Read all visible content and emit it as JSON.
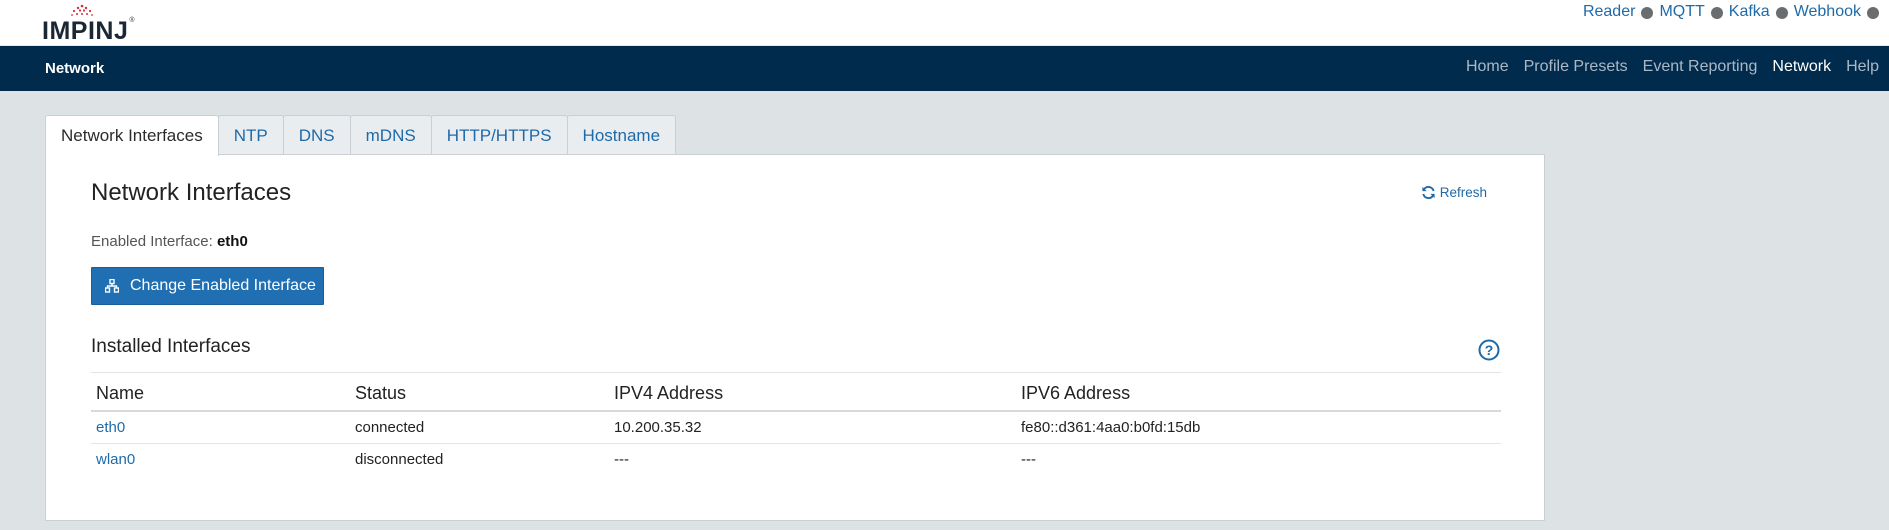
{
  "brand": {
    "name": "IMPINJ",
    "mark": "®"
  },
  "status_links": [
    {
      "label": "Reader",
      "icon": "status-dot-icon"
    },
    {
      "label": "MQTT",
      "icon": "status-dot-icon"
    },
    {
      "label": "Kafka",
      "icon": "status-dot-icon"
    },
    {
      "label": "Webhook",
      "icon": "status-dot-icon"
    }
  ],
  "colors": {
    "navbar": "#012b4d",
    "accent": "#1f6fb2",
    "link": "#1e6aa8",
    "background": "#dde2e5",
    "status_dot": "#6a6d70"
  },
  "navbar": {
    "title": "Network",
    "items": [
      {
        "label": "Home",
        "active": false
      },
      {
        "label": "Profile Presets",
        "active": false
      },
      {
        "label": "Event Reporting",
        "active": false
      },
      {
        "label": "Network",
        "active": true
      },
      {
        "label": "Help",
        "active": false
      }
    ]
  },
  "tabs": [
    {
      "label": "Network Interfaces",
      "active": true
    },
    {
      "label": "NTP",
      "active": false
    },
    {
      "label": "DNS",
      "active": false
    },
    {
      "label": "mDNS",
      "active": false
    },
    {
      "label": "HTTP/HTTPS",
      "active": false
    },
    {
      "label": "Hostname",
      "active": false
    }
  ],
  "panel": {
    "title": "Network Interfaces",
    "refresh_label": "Refresh",
    "enabled_label": "Enabled Interface:",
    "enabled_value": "eth0",
    "change_button": "Change Enabled Interface",
    "section_title": "Installed Interfaces",
    "help_icon": "question-circle-icon",
    "table": {
      "columns": [
        "Name",
        "Status",
        "IPV4 Address",
        "IPV6 Address"
      ],
      "rows": [
        {
          "name": "eth0",
          "status": "connected",
          "ipv4": "10.200.35.32",
          "ipv6": "fe80::d361:4aa0:b0fd:15db"
        },
        {
          "name": "wlan0",
          "status": "disconnected",
          "ipv4": "---",
          "ipv6": "---"
        }
      ]
    }
  }
}
